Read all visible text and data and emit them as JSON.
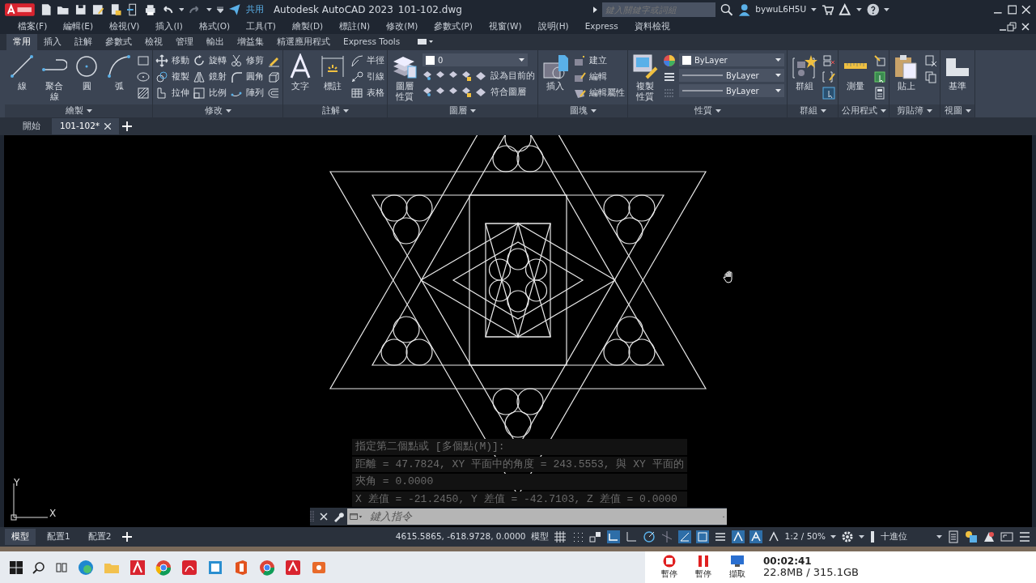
{
  "title_bar": {
    "share": "共用",
    "app_title": "Autodesk AutoCAD 2023",
    "file_name": "101-102.dwg",
    "search": {
      "placeholder": "鍵入關鍵字或詞組"
    },
    "user": "bywuL6H5U"
  },
  "menu": [
    "檔案(F)",
    "編輯(E)",
    "檢視(V)",
    "插入(I)",
    "格式(O)",
    "工具(T)",
    "繪製(D)",
    "標註(N)",
    "修改(M)",
    "參數式(P)",
    "視窗(W)",
    "說明(H)",
    "Express",
    "資料檢視"
  ],
  "ribbon_tabs": [
    {
      "label": "常用",
      "selected": true
    },
    {
      "label": "插入",
      "selected": false
    },
    {
      "label": "註解",
      "selected": false
    },
    {
      "label": "參數式",
      "selected": false
    },
    {
      "label": "檢視",
      "selected": false
    },
    {
      "label": "管理",
      "selected": false
    },
    {
      "label": "輸出",
      "selected": false
    },
    {
      "label": "增益集",
      "selected": false
    },
    {
      "label": "精選應用程式",
      "selected": false
    },
    {
      "label": "Express Tools",
      "selected": false
    }
  ],
  "ribbon_panels": [
    {
      "label": "繪製",
      "groups": [
        {
          "kind": "large",
          "label": "線"
        },
        {
          "kind": "large",
          "label": "聚合線"
        },
        {
          "kind": "large",
          "label": "圓"
        },
        {
          "kind": "large",
          "label": "弧"
        },
        {
          "kind": "stack",
          "items": [
            {
              "kind": "icon"
            },
            {
              "kind": "icon"
            },
            {
              "kind": "icon"
            }
          ]
        }
      ]
    },
    {
      "label": "修改",
      "groups": [
        {
          "kind": "stack",
          "items": [
            {
              "kind": "tool",
              "label": "移動"
            },
            {
              "kind": "tool",
              "label": "複製"
            },
            {
              "kind": "tool",
              "label": "拉伸"
            }
          ]
        },
        {
          "kind": "stack",
          "items": [
            {
              "kind": "tool",
              "label": "旋轉"
            },
            {
              "kind": "tool",
              "label": "鏡射"
            },
            {
              "kind": "tool",
              "label": "比例"
            }
          ]
        },
        {
          "kind": "stack",
          "items": [
            {
              "kind": "tool",
              "label": "修剪"
            },
            {
              "kind": "tool",
              "label": "圓角"
            },
            {
              "kind": "tool",
              "label": "陣列"
            }
          ]
        },
        {
          "kind": "stack",
          "items": [
            {
              "kind": "icon"
            },
            {
              "kind": "icon"
            },
            {
              "kind": "icon"
            }
          ]
        }
      ]
    },
    {
      "label": "註解",
      "groups": [
        {
          "kind": "large",
          "label": "文字"
        },
        {
          "kind": "large",
          "label": "標註"
        },
        {
          "kind": "stack",
          "items": [
            {
              "kind": "tool",
              "label": "半徑"
            },
            {
              "kind": "tool",
              "label": "引線"
            },
            {
              "kind": "tool",
              "label": "表格"
            }
          ]
        }
      ]
    },
    {
      "label": "圖層",
      "groups": [
        {
          "kind": "large",
          "label": "圖層性質"
        },
        {
          "kind": "stack",
          "items": [
            {
              "kind": "dropdown",
              "value": "0",
              "color": "#ffffff"
            },
            {
              "kind": "tool",
              "label": "設為目前的"
            },
            {
              "kind": "tool",
              "label": "符合圖層"
            }
          ]
        }
      ]
    },
    {
      "label": "圖塊",
      "groups": [
        {
          "kind": "large",
          "label": "插入"
        },
        {
          "kind": "stack",
          "items": [
            {
              "kind": "tool",
              "label": "建立"
            },
            {
              "kind": "tool",
              "label": "編輯"
            },
            {
              "kind": "tool",
              "label": "編輯屬性"
            }
          ]
        }
      ]
    },
    {
      "label": "性質",
      "groups": [
        {
          "kind": "large",
          "label": "複製性質"
        },
        {
          "kind": "stack",
          "items": [
            {
              "kind": "icon"
            },
            {
              "kind": "icon"
            },
            {
              "kind": "icon"
            }
          ]
        },
        {
          "kind": "stack",
          "items": [
            {
              "kind": "dropdown",
              "value": "ByLayer",
              "color": "#ffffff"
            },
            {
              "kind": "linedrop",
              "value": "ByLayer"
            },
            {
              "kind": "linedrop",
              "value": "ByLayer"
            }
          ]
        }
      ]
    },
    {
      "label": "群組",
      "groups": [
        {
          "kind": "large",
          "label": "群組"
        },
        {
          "kind": "stack",
          "items": [
            {
              "kind": "icon"
            },
            {
              "kind": "icon"
            },
            {
              "kind": "icon"
            }
          ]
        }
      ]
    },
    {
      "label": "公用程式",
      "groups": [
        {
          "kind": "large",
          "label": "測量"
        },
        {
          "kind": "stack",
          "items": [
            {
              "kind": "icon"
            },
            {
              "kind": "icon"
            },
            {
              "kind": "icon"
            }
          ]
        }
      ]
    },
    {
      "label": "剪貼簿",
      "groups": [
        {
          "kind": "large",
          "label": "貼上"
        },
        {
          "kind": "stack",
          "items": [
            {
              "kind": "icon"
            },
            {
              "kind": "icon"
            }
          ]
        }
      ]
    },
    {
      "label": "視圖",
      "groups": [
        {
          "kind": "large",
          "label": "基準"
        }
      ]
    }
  ],
  "file_tabs": [
    {
      "label": "開始",
      "selected": false
    },
    {
      "label": "101-102*",
      "selected": true
    }
  ],
  "command_history": [
    "指定第二個點或 [多個點(M)]:",
    "距離 = 47.7824, XY 平面中的角度 = 243.5553, 與 XY 平面的",
    "夾角 = 0.0000",
    "X 差值 = -21.2450, Y 差值 = -42.7103, Z 差值 = 0.0000"
  ],
  "command_line": {
    "placeholder": "鍵入指令"
  },
  "ucs": {
    "y": "Y",
    "x": "X"
  },
  "layout_tabs": [
    {
      "label": "模型",
      "selected": true
    },
    {
      "label": "配置1",
      "selected": false
    },
    {
      "label": "配置2",
      "selected": false
    }
  ],
  "status_bar": {
    "coordinates": "4615.5865, -618.9728, 0.0000",
    "space": "模型",
    "scale": "1:2 / 50%",
    "units": "十進位"
  },
  "recorder": {
    "clock": "00:02:41",
    "buttons": [
      "暫停",
      "暫停",
      "擷取"
    ],
    "storage": "22.8MB / 315.1GB"
  }
}
